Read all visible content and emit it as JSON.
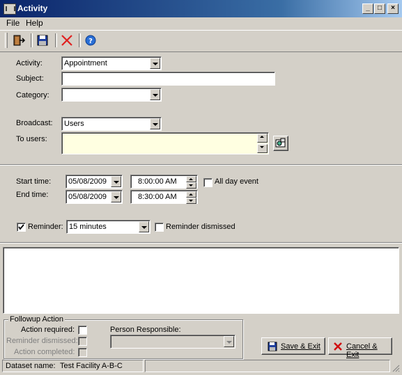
{
  "window": {
    "title": "Activity"
  },
  "menu": {
    "file": "File",
    "help": "Help"
  },
  "toolbar": {
    "exit_icon": "exit-door-icon",
    "save_icon": "floppy-disk-icon",
    "delete_icon": "red-x-icon",
    "help_icon": "help-circle-icon"
  },
  "form": {
    "activity_label": "Activity:",
    "activity_value": "Appointment",
    "subject_label": "Subject:",
    "subject_value": "",
    "category_label": "Category:",
    "category_value": "",
    "broadcast_label": "Broadcast:",
    "broadcast_value": "Users",
    "to_users_label": "To users:",
    "to_users_value": ""
  },
  "schedule": {
    "start_label": "Start time:",
    "start_date": "05/08/2009",
    "start_time": "8:00:00 AM",
    "end_label": "End time:",
    "end_date": "05/08/2009",
    "end_time": "8:30:00 AM",
    "all_day_label": "All day event",
    "all_day_checked": false
  },
  "reminder": {
    "label": "Reminder:",
    "checked": true,
    "value": "15 minutes",
    "dismissed_label": "Reminder dismissed",
    "dismissed_checked": false
  },
  "followup": {
    "legend": "Followup Action",
    "action_required_label": "Action required:",
    "reminder_dismissed_label": "Reminder dismissed:",
    "action_completed_label": "Action completed:",
    "person_label": "Person Responsible:",
    "person_value": ""
  },
  "buttons": {
    "save_exit": "Save & Exit",
    "cancel_exit": "Cancel & Exit"
  },
  "status": {
    "dataset_label": "Dataset name:",
    "dataset_value": "Test Facility A-B-C"
  },
  "colors": {
    "title_start": "#0a246a",
    "title_end": "#a6caf0",
    "to_users_bg": "#ffffe1",
    "face": "#d4d0c8"
  }
}
